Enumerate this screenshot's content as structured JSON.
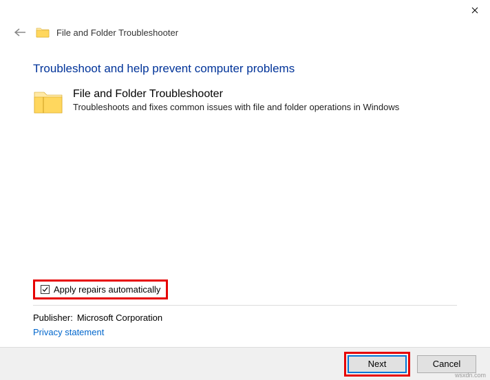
{
  "window": {
    "title": "File and Folder Troubleshooter"
  },
  "section": {
    "heading": "Troubleshoot and help prevent computer problems",
    "item_title": "File and Folder Troubleshooter",
    "item_desc": "Troubleshoots and fixes common issues with file and folder operations in Windows"
  },
  "options": {
    "apply_label": "Apply repairs automatically"
  },
  "publisher": {
    "label": "Publisher:",
    "value": "Microsoft Corporation",
    "privacy_link": "Privacy statement"
  },
  "buttons": {
    "next": "Next",
    "cancel": "Cancel"
  },
  "watermark": "wsxdn.com"
}
